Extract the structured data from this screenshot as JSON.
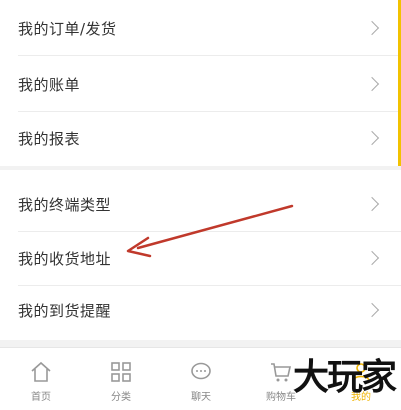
{
  "menu": {
    "group1": [
      {
        "label": "我的订单/发货"
      },
      {
        "label": "我的账单"
      },
      {
        "label": "我的报表"
      }
    ],
    "group2": [
      {
        "label": "我的终端类型"
      },
      {
        "label": "我的收货地址"
      },
      {
        "label": "我的到货提醒"
      }
    ]
  },
  "tabbar": {
    "items": [
      {
        "label": "首页",
        "icon": "home-icon"
      },
      {
        "label": "分类",
        "icon": "grid-icon"
      },
      {
        "label": "聊天",
        "icon": "chat-icon"
      },
      {
        "label": "购物车",
        "icon": "cart-icon"
      },
      {
        "label": "我的",
        "icon": "user-icon"
      }
    ]
  },
  "watermark": {
    "text": "大玩家"
  },
  "colors": {
    "accent": "#f0b400",
    "annotation": "#c0392b"
  }
}
